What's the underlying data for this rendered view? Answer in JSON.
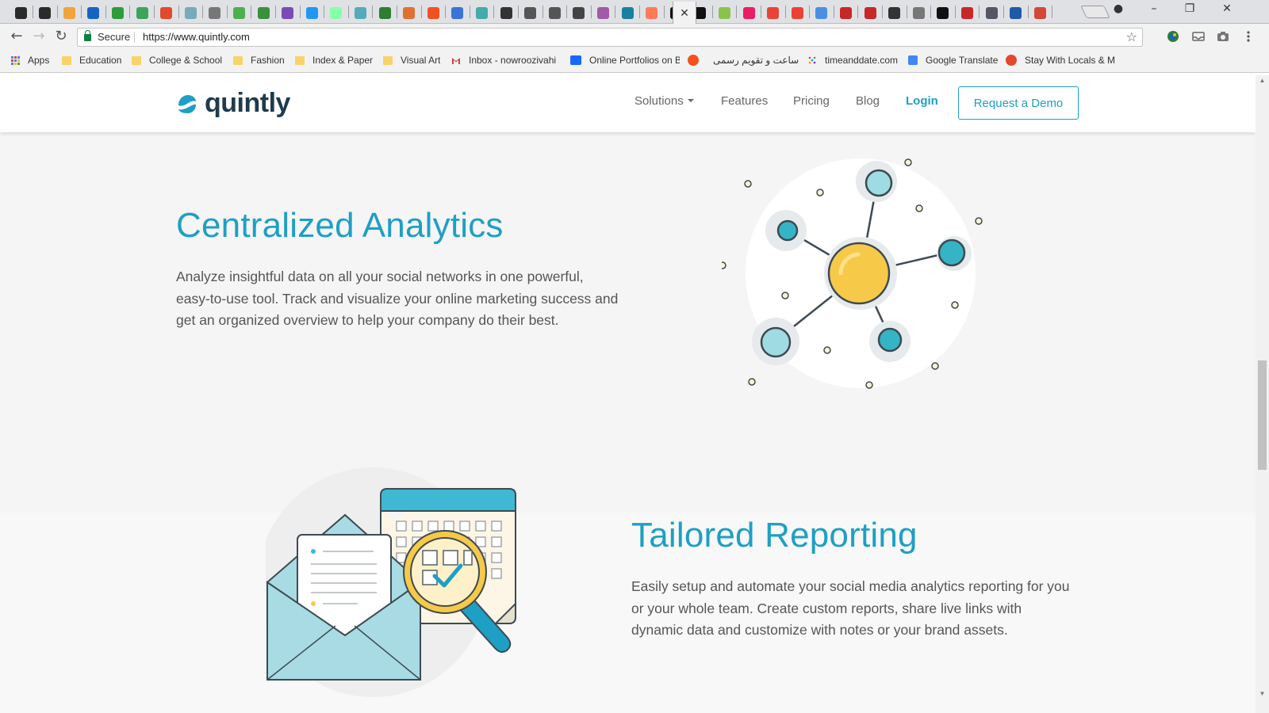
{
  "browser": {
    "url": "https://www.quintly.com",
    "secure_label": "Secure",
    "bookmarks": [
      {
        "label": "Apps",
        "icon": "apps-grid-icon"
      },
      {
        "label": "Education",
        "icon": "folder-icon"
      },
      {
        "label": "College & School",
        "icon": "folder-icon"
      },
      {
        "label": "Fashion",
        "icon": "folder-icon"
      },
      {
        "label": "Index & Paper",
        "icon": "folder-icon"
      },
      {
        "label": "Visual Art",
        "icon": "folder-icon"
      },
      {
        "label": "Inbox - nowroozivahi",
        "icon": "gmail-icon"
      },
      {
        "label": "Online Portfolios on B",
        "icon": "behance-icon"
      },
      {
        "label": "",
        "icon": "t-icon"
      },
      {
        "label": "ساعت و تقویم رسمی",
        "icon": "dots-icon"
      },
      {
        "label": "timeanddate.com",
        "icon": "timeanddate-icon"
      },
      {
        "label": "Google Translate",
        "icon": "translate-icon"
      },
      {
        "label": "Stay With Locals & M",
        "icon": "couchsurfing-icon"
      }
    ],
    "tab_colors": [
      "#2b2b2b",
      "#2b2b2b",
      "#f0a43a",
      "#1565c0",
      "#2e9b3c",
      "#3ca55c",
      "#e24a2e",
      "#7ab",
      "#777",
      "#4caf50",
      "#3c8f3c",
      "#7b4bb5",
      "#2196f3",
      "#8fa",
      "#5ab",
      "#2e7d32",
      "#e07030",
      "#f25022",
      "#3b73d6",
      "#4aa",
      "#333",
      "#555",
      "#555",
      "#444",
      "#a05aa6",
      "#1b7fa0",
      "#ff7a59",
      "#111",
      "#111",
      "#8bc34a",
      "#e91e63",
      "#ea4335",
      "#ea4335",
      "#4a90e2",
      "#c62828",
      "#c62828",
      "#333",
      "#777",
      "#111",
      "#c62828",
      "#556",
      "#1e5aa8",
      "#d44638"
    ]
  },
  "site": {
    "logo_text": "quintly",
    "nav": {
      "solutions": "Solutions",
      "features": "Features",
      "pricing": "Pricing",
      "blog": "Blog",
      "login": "Login",
      "demo": "Request a Demo"
    }
  },
  "sections": {
    "analytics": {
      "title": "Centralized Analytics",
      "body": "Analyze insightful data on all your social networks in one powerful, easy-to-use tool. Track and visualize your online marketing success and get an organized overview to help your company do their best."
    },
    "reporting": {
      "title": "Tailored Reporting",
      "body": "Easily setup and automate your social media analytics reporting for you or your whole team. Create custom reports, share live links with dynamic data and customize with notes or your brand assets."
    }
  },
  "colors": {
    "accent": "#1e9fc4",
    "logo_dark": "#1f3b4d",
    "node_yellow": "#f7c948",
    "node_teal": "#35b4c6",
    "node_light": "#9fdbe3"
  }
}
